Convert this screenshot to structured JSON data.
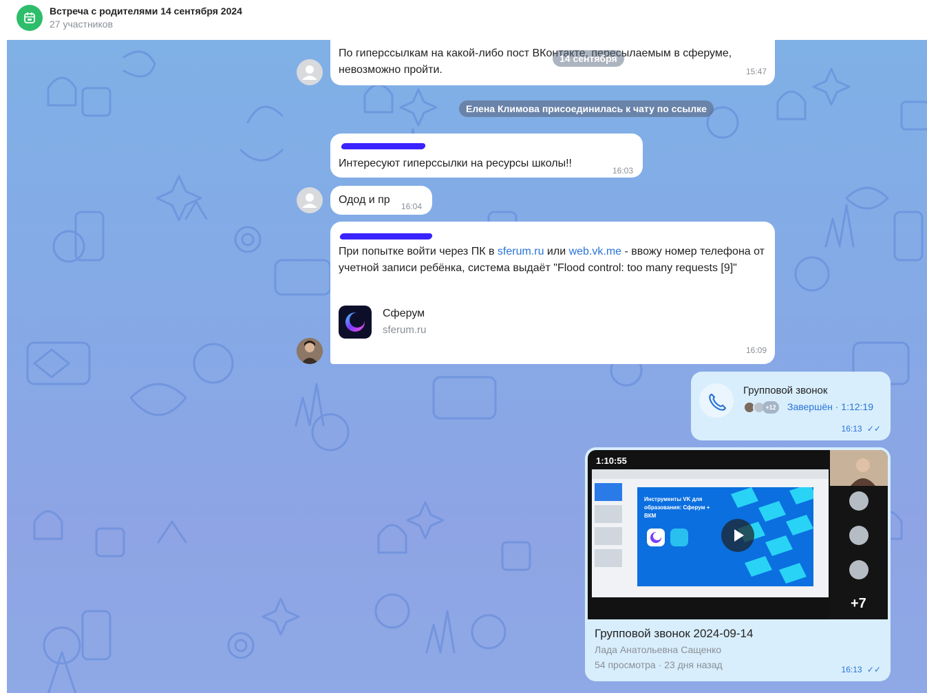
{
  "header": {
    "title": "Встреча с родителями 14 сентября 2024",
    "subtitle": "27 участников"
  },
  "date_pill": "14 сентября",
  "messages": {
    "m1": {
      "text": "По гиперссылкам на какой-либо пост ВКонтакте, пересылаемым в сферуме, невозможно пройти.",
      "time": "15:47"
    },
    "system": "Елена Климова присоединилась к чату по ссылке",
    "m2": {
      "text": "Интересуют гиперссылки на ресурсы школы!!",
      "time": "16:03"
    },
    "m3": {
      "text": "Одод и пр",
      "time": "16:04"
    },
    "m4": {
      "text_before": "При попытке войти через ПК в ",
      "link1": "sferum.ru",
      "text_mid": " или ",
      "link2": "web.vk.me",
      "text_after": " - ввожу номер телефона от учетной записи ребёнка, система выдаёт \"Flood control: too many requests [9]\"",
      "preview_title": "Сферум",
      "preview_domain": "sferum.ru",
      "time": "16:09"
    }
  },
  "call": {
    "title": "Групповой звонок",
    "extra_count": "+12",
    "status": "Завершён · 1:12:19",
    "time": "16:13"
  },
  "video": {
    "duration": "1:10:55",
    "slide_heading": "Инструменты VK для образования: Сферум + ВКМ",
    "more_participants": "+7",
    "title": "Групповой звонок 2024-09-14",
    "author": "Лада Анатольевна Сащенко",
    "stats": "54 просмотра · 23 дня назад",
    "time": "16:13"
  },
  "colors": {
    "accent": "#2a73d6",
    "chat_bg": "#86a9e6",
    "own_bubble": "#d8eefc",
    "header_icon": "#2ebd6b"
  }
}
